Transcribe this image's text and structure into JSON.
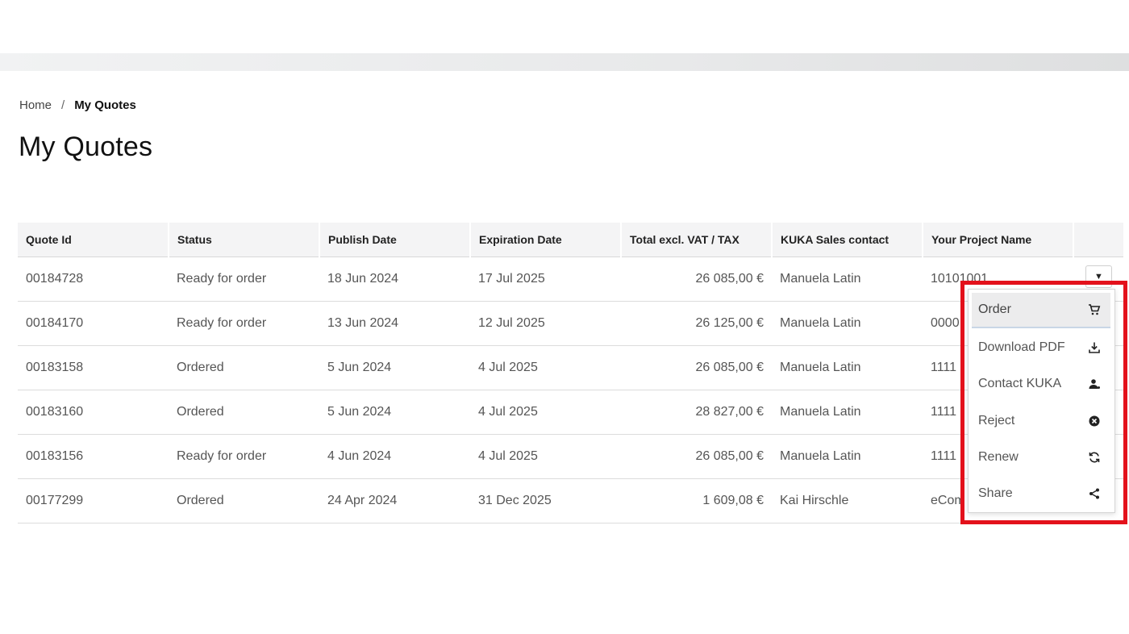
{
  "breadcrumb": {
    "home": "Home",
    "separator": "/",
    "current": "My Quotes"
  },
  "page": {
    "title": "My Quotes"
  },
  "table": {
    "headers": [
      "Quote Id",
      "Status",
      "Publish Date",
      "Expiration Date",
      "Total excl. VAT / TAX",
      "KUKA Sales contact",
      "Your Project Name",
      ""
    ],
    "rows": [
      {
        "quote_id": "00184728",
        "status": "Ready for order",
        "publish_date": "18 Jun 2024",
        "expiration_date": "17 Jul 2025",
        "total": "26 085,00 €",
        "sales_contact": "Manuela Latin",
        "project_name": "10101001"
      },
      {
        "quote_id": "00184170",
        "status": "Ready for order",
        "publish_date": "13 Jun 2024",
        "expiration_date": "12 Jul 2025",
        "total": "26 125,00 €",
        "sales_contact": "Manuela Latin",
        "project_name": "0000"
      },
      {
        "quote_id": "00183158",
        "status": "Ordered",
        "publish_date": "5 Jun 2024",
        "expiration_date": "4 Jul 2025",
        "total": "26 085,00 €",
        "sales_contact": "Manuela Latin",
        "project_name": "1111"
      },
      {
        "quote_id": "00183160",
        "status": "Ordered",
        "publish_date": "5 Jun 2024",
        "expiration_date": "4 Jul 2025",
        "total": "28 827,00 €",
        "sales_contact": "Manuela Latin",
        "project_name": "1111"
      },
      {
        "quote_id": "00183156",
        "status": "Ready for order",
        "publish_date": "4 Jun 2024",
        "expiration_date": "4 Jul 2025",
        "total": "26 085,00 €",
        "sales_contact": "Manuela Latin",
        "project_name": "1111"
      },
      {
        "quote_id": "00177299",
        "status": "Ordered",
        "publish_date": "24 Apr 2024",
        "expiration_date": "31 Dec 2025",
        "total": "1 609,08 €",
        "sales_contact": "Kai Hirschle",
        "project_name": "eCom"
      }
    ]
  },
  "row_actions": {
    "toggle_glyph": "▼",
    "menu": [
      {
        "label": "Order",
        "icon": "cart-icon"
      },
      {
        "label": "Download PDF",
        "icon": "download-icon"
      },
      {
        "label": "Contact KUKA",
        "icon": "person-icon"
      },
      {
        "label": "Reject",
        "icon": "reject-icon"
      },
      {
        "label": "Renew",
        "icon": "renew-icon"
      },
      {
        "label": "Share",
        "icon": "share-icon"
      }
    ]
  },
  "colors": {
    "highlight": "#e3111b",
    "header_bg": "#f4f4f5",
    "active_item_bg": "#ececed"
  }
}
